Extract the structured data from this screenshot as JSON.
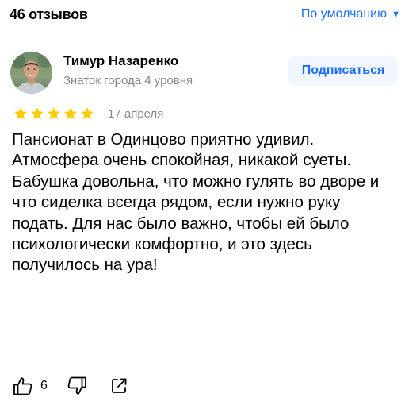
{
  "header": {
    "reviews_count": "46 отзывов",
    "sort_label": "По умолчанию",
    "sort_caret_icon": "caret-down-icon"
  },
  "review": {
    "author": {
      "name": "Тимур Назаренко",
      "level": "Знаток города 4 уровня",
      "avatar_icon": "user-photo"
    },
    "subscribe_label": "Подписаться",
    "rating": 5,
    "rating_max": 5,
    "date": "17 апреля",
    "text": "Пансионат в Одинцово приятно удивил. Атмосфера очень спокойная, никакой суеты. Бабушка довольна, что можно гулять во дворе и что сиделка всегда рядом, если нужно руку подать. Для нас было важно, чтобы ей было психологически комфортно, и это здесь получилось на ура!",
    "actions": {
      "like_icon": "thumbs-up-icon",
      "like_count": "6",
      "dislike_icon": "thumbs-down-icon",
      "share_icon": "share-icon"
    }
  },
  "colors": {
    "accent": "#196dff",
    "star": "#fc0",
    "muted_text": "#888888",
    "button_bg": "#f2f6ff"
  }
}
